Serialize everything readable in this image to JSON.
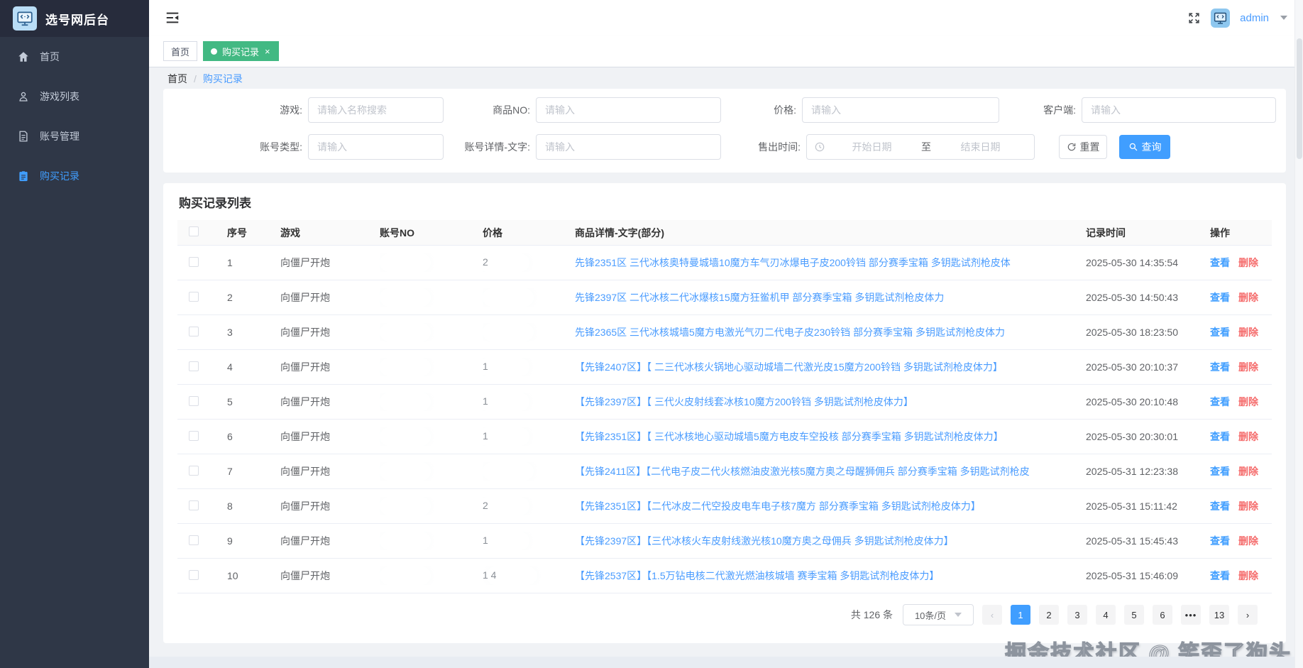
{
  "app": {
    "title": "选号网后台",
    "user": "admin"
  },
  "sidebar": {
    "items": [
      {
        "key": "home",
        "label": "首页",
        "icon": "home-icon",
        "active": false
      },
      {
        "key": "game-list",
        "label": "游戏列表",
        "icon": "user-icon",
        "active": false
      },
      {
        "key": "account-management",
        "label": "账号管理",
        "icon": "document-icon",
        "active": false
      },
      {
        "key": "purchase-records",
        "label": "购买记录",
        "icon": "clipboard-icon",
        "active": true
      }
    ]
  },
  "tabsbar": {
    "tabs": [
      {
        "label": "首页",
        "active": false,
        "closable": false
      },
      {
        "label": "购买记录",
        "active": true,
        "closable": true
      }
    ]
  },
  "breadcrumb": {
    "items": [
      "首页",
      "购买记录"
    ],
    "separator": "/"
  },
  "filters": {
    "fields_row1": [
      {
        "label": "游戏:",
        "placeholder": "请输入名称搜索"
      },
      {
        "label": "商品NO:",
        "placeholder": "请输入"
      },
      {
        "label": "价格:",
        "placeholder": "请输入"
      },
      {
        "label": "客户端:",
        "placeholder": "请输入"
      }
    ],
    "fields_row2": [
      {
        "label": "账号类型:",
        "placeholder": "请输入"
      },
      {
        "label": "账号详情-文字:",
        "placeholder": "请输入"
      }
    ],
    "date_field": {
      "label": "售出时间:",
      "start_placeholder": "开始日期",
      "separator": "至",
      "end_placeholder": "结束日期"
    },
    "reset_label": "重置",
    "search_label": "查询"
  },
  "list": {
    "title": "购买记录列表",
    "columns": [
      "序号",
      "游戏",
      "账号NO",
      "价格",
      "商品详情-文字(部分)",
      "记录时间",
      "操作"
    ],
    "view_label": "查看",
    "delete_label": "删除",
    "rows": [
      {
        "no": "1",
        "game": "向僵尸开炮",
        "price_partial": "2",
        "detail": "先锋2351区 三代冰核奥特曼城墙10魔方车气刃冰爆电子皮200铃铛 部分赛季宝箱 多钥匙试剂枪皮体",
        "time": "2025-05-30 14:35:54"
      },
      {
        "no": "2",
        "game": "向僵尸开炮",
        "price_partial": "",
        "detail": "先锋2397区 二代冰核二代冰爆核15魔方狂鲎机甲 部分赛季宝箱 多钥匙试剂枪皮体力",
        "time": "2025-05-30 14:50:43"
      },
      {
        "no": "3",
        "game": "向僵尸开炮",
        "price_partial": "",
        "detail": "先锋2365区 三代冰核城墙5魔方电激光气刃二代电子皮230铃铛 部分赛季宝箱 多钥匙试剂枪皮体力",
        "time": "2025-05-30 18:23:50"
      },
      {
        "no": "4",
        "game": "向僵尸开炮",
        "price_partial": "1",
        "detail": "【先锋2407区】【 二三代冰核火锅地心驱动城墙二代激光皮15魔方200铃铛 多钥匙试剂枪皮体力】",
        "time": "2025-05-30 20:10:37"
      },
      {
        "no": "5",
        "game": "向僵尸开炮",
        "price_partial": "1",
        "detail": "【先锋2397区】【 三代火皮射线套冰核10魔方200铃铛 多钥匙试剂枪皮体力】",
        "time": "2025-05-30 20:10:48"
      },
      {
        "no": "6",
        "game": "向僵尸开炮",
        "price_partial": "1",
        "detail": "【先锋2351区】【 三代冰核地心驱动城墙5魔方电皮车空投核 部分赛季宝箱 多钥匙试剂枪皮体力】",
        "time": "2025-05-30 20:30:01"
      },
      {
        "no": "7",
        "game": "向僵尸开炮",
        "price_partial": "",
        "detail": "【先锋2411区】【二代电子皮二代火核燃油皮激光核5魔方奥之母醒狮佣兵 部分赛季宝箱 多钥匙试剂枪皮",
        "time": "2025-05-31 12:23:38"
      },
      {
        "no": "8",
        "game": "向僵尸开炮",
        "price_partial": "2",
        "detail": "【先锋2351区】【二代冰皮二代空投皮电车电子核7魔方 部分赛季宝箱 多钥匙试剂枪皮体力】",
        "time": "2025-05-31 15:11:42"
      },
      {
        "no": "9",
        "game": "向僵尸开炮",
        "price_partial": "1",
        "detail": "【先锋2397区】【三代冰核火车皮射线激光核10魔方奥之母佣兵 多钥匙试剂枪皮体力】",
        "time": "2025-05-31 15:45:43"
      },
      {
        "no": "10",
        "game": "向僵尸开炮",
        "price_partial": "1 4",
        "detail": "【先锋2537区】【1.5万钻电核二代激光燃油核城墙 赛季宝箱 多钥匙试剂枪皮体力】",
        "time": "2025-05-31 15:46:09"
      }
    ]
  },
  "pagination": {
    "total": "共 126 条",
    "page_size": "10条/页",
    "prev": "‹",
    "next": "›",
    "pages": [
      "1",
      "2",
      "3",
      "4",
      "5",
      "6",
      "•••",
      "13"
    ],
    "active": "1"
  },
  "watermark": "掘金技术社区 @ 笑歪了狗头",
  "colors": {
    "accent_blue": "#409eff",
    "link_blue": "#4a9cff",
    "tab_green": "#42b983",
    "danger_red": "#f56c6c",
    "sidebar_bg": "#2f3747",
    "sidebar_logo_bg": "#272c3c",
    "content_bg": "#f0f2f5"
  }
}
